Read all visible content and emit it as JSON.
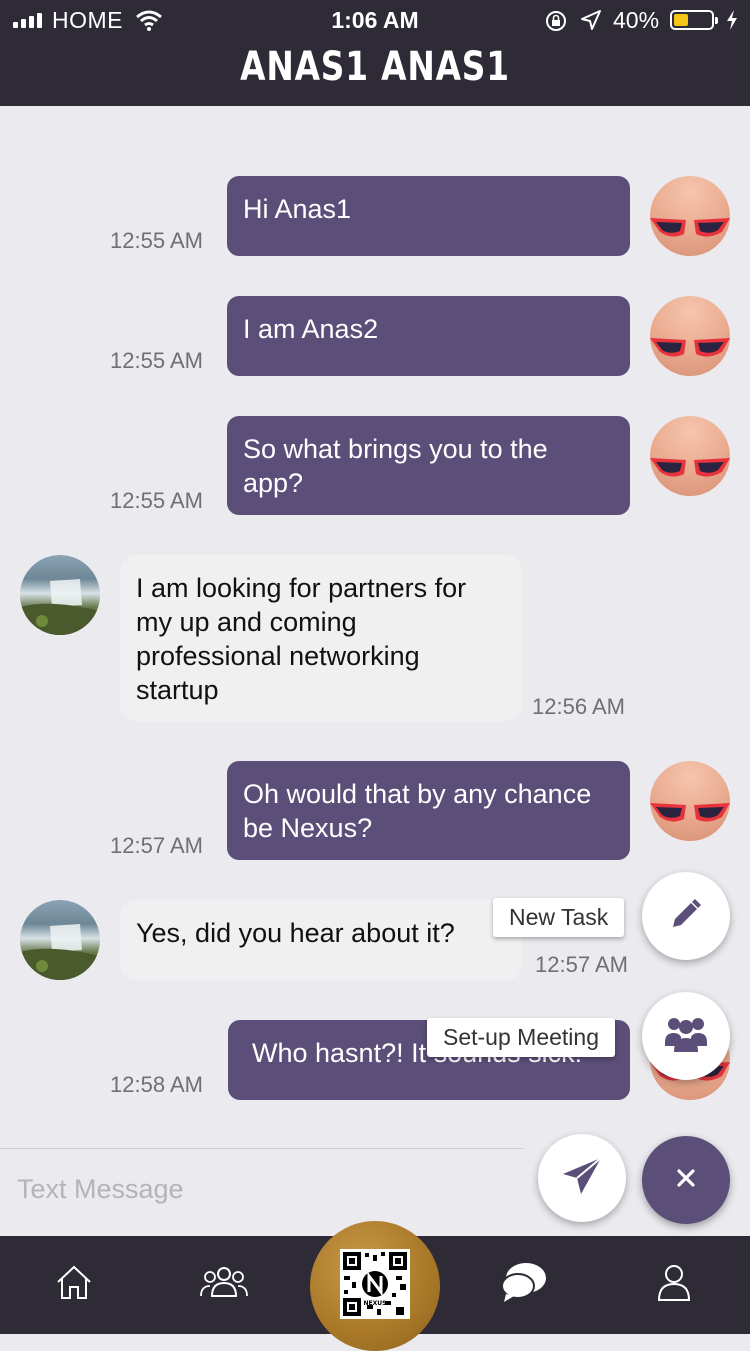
{
  "status_bar": {
    "carrier": "HOME",
    "time": "1:06 AM",
    "battery": "40%",
    "battery_level": 0.4
  },
  "header": {
    "title": "ANAS1 ANAS1"
  },
  "messages": [
    {
      "direction": "out",
      "text": "Hi Anas1",
      "time": "12:55 AM"
    },
    {
      "direction": "out",
      "text": "I am Anas2",
      "time": "12:55 AM"
    },
    {
      "direction": "out",
      "text": "So what brings you to the app?",
      "time": "12:55 AM"
    },
    {
      "direction": "in",
      "text": "I am looking for partners for my up and coming professional networking startup",
      "time": "12:56 AM"
    },
    {
      "direction": "out",
      "text": "Oh would that by any chance be Nexus?",
      "time": "12:57 AM"
    },
    {
      "direction": "in",
      "text": "Yes, did you hear about it?",
      "time": "12:57 AM"
    },
    {
      "direction": "out",
      "text": "Who hasnt?! It sounds sick!",
      "time": "12:58 AM"
    }
  ],
  "fab_menu": {
    "new_task_label": "New Task",
    "meeting_label": "Set-up Meeting",
    "new_task_icon": "pencil-icon",
    "meeting_icon": "group-icon",
    "close_icon": "close-icon"
  },
  "composer": {
    "placeholder": "Text Message",
    "send_icon": "send-icon"
  },
  "bottom_nav": {
    "items": [
      "home-icon",
      "contacts-icon",
      "qr-code",
      "chat-icon",
      "profile-icon"
    ],
    "qr_text": "NEXUS"
  },
  "colors": {
    "header_bg": "#2e2a36",
    "outgoing_bubble": "#5b4e78",
    "incoming_bubble": "#f0f0f0",
    "background": "#ebeaef",
    "accent_gold": "#a87828"
  }
}
